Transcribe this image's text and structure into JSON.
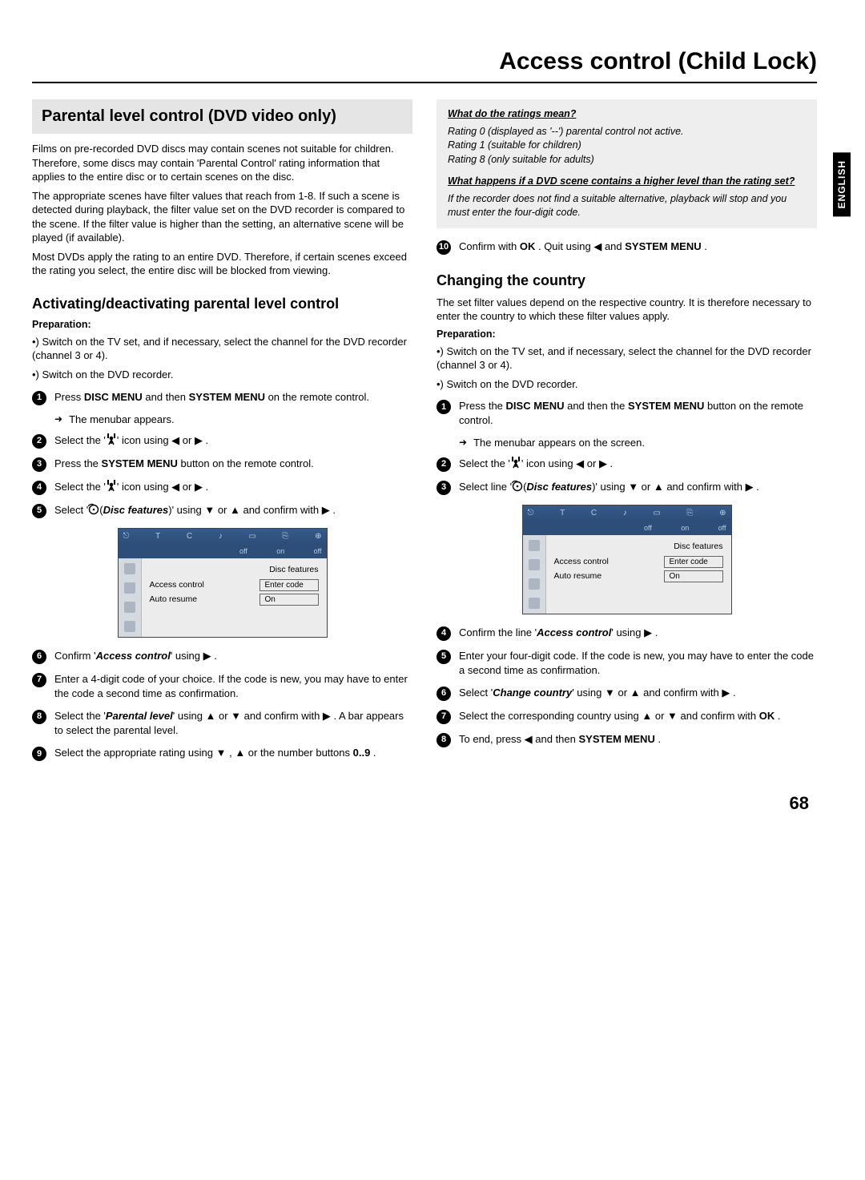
{
  "chapter_title": "Access control (Child Lock)",
  "language_tab": "ENGLISH",
  "page_number": "68",
  "left": {
    "banner": "Parental level control (DVD video only)",
    "intro_p1": "Films on pre-recorded DVD discs may contain scenes not suitable for children. Therefore, some discs may contain 'Parental Control' rating information that applies to the entire disc or to certain scenes on the disc.",
    "intro_p2": "The appropriate scenes have filter values that reach from 1-8. If such a scene is detected during playback, the filter value set on the DVD recorder is compared to the scene. If the filter value is higher than the setting, an alternative scene will be played (if available).",
    "intro_p3": "Most DVDs apply the rating to an entire DVD. Therefore, if certain scenes exceed the rating you select, the entire disc will be blocked from viewing.",
    "h_activate": "Activating/deactivating parental level control",
    "prep_label": "Preparation:",
    "prep_1": "•) Switch on the TV set, and if necessary, select the channel for the DVD recorder (channel 3 or 4).",
    "prep_2": "•) Switch on the DVD recorder.",
    "s1_a": "Press ",
    "s1_b": "DISC MENU",
    "s1_c": " and then ",
    "s1_d": "SYSTEM MENU",
    "s1_e": " on the remote control.",
    "s1_sub": "The menubar appears.",
    "s2_a": "Select the '",
    "s2_b": "' icon using ◀ or ▶ .",
    "s3_a": "Press the ",
    "s3_b": "SYSTEM MENU",
    "s3_c": " button on the remote control.",
    "s4_a": "Select the '",
    "s4_b": "' icon using ◀ or ▶ .",
    "s5_a": "Select '",
    "s5_feat": "Disc features",
    "s5_b": ")' using ▼ or ▲ and confirm with ▶ .",
    "s6_a": "Confirm '",
    "s6_b": "Access control",
    "s6_c": "' using ▶ .",
    "s7": "Enter a 4-digit code of your choice. If the code is new, you may have to enter the code a second time as confirmation.",
    "s8_a": "Select the '",
    "s8_b": "Parental level",
    "s8_c": "' using ▲ or ▼ and confirm with ▶ . A bar appears to select the parental level.",
    "s9_a": "Select the appropriate rating using ▼ , ▲ or the number buttons ",
    "s9_b": "0..9",
    "s9_c": " ."
  },
  "osd": {
    "tabs": [
      "off",
      "on",
      "off"
    ],
    "title": "Disc features",
    "row1_label": "Access control",
    "row1_field": "Enter code",
    "row2_label": "Auto resume",
    "row2_field": "On"
  },
  "right": {
    "box1_q": "What do the ratings mean?",
    "box1_l1": "Rating 0 (displayed as '--') parental control not active.",
    "box1_l2": "Rating 1 (suitable for children)",
    "box1_l3": "Rating 8 (only suitable for adults)",
    "box1_q2": "What happens if a DVD scene contains a higher level than the rating set?",
    "box1_a2": "If the recorder does not find a suitable alternative, playback will stop and you must enter the four-digit code.",
    "s10_a": "Confirm with ",
    "s10_b": "OK",
    "s10_c": " . Quit using ◀ and ",
    "s10_d": "SYSTEM MENU",
    "s10_e": " .",
    "h_country": "Changing the country",
    "country_intro": "The set filter values depend on the respective country. It is therefore necessary to enter the country to which these filter values apply.",
    "prep_label": "Preparation:",
    "prep_1": "•) Switch on the TV set, and if necessary, select the channel for the DVD recorder (channel 3 or 4).",
    "prep_2": "•) Switch on the DVD recorder.",
    "c1_a": "Press the ",
    "c1_b": "DISC MENU",
    "c1_c": " and then the ",
    "c1_d": "SYSTEM MENU",
    "c1_e": " button on the remote control.",
    "c1_sub": "The menubar appears on the screen.",
    "c2_a": "Select the '",
    "c2_b": "' icon using ◀ or ▶ .",
    "c3_a": "Select line '",
    "c3_feat": "Disc features",
    "c3_b": ")' using ▼ or ▲ and confirm with ▶ .",
    "c4_a": "Confirm the line '",
    "c4_b": "Access control",
    "c4_c": "' using ▶ .",
    "c5": "Enter your four-digit code. If the code is new, you may have to enter the code a second time as confirmation.",
    "c6_a": "Select '",
    "c6_b": "Change country",
    "c6_c": "' using ▼ or ▲ and confirm with ▶ .",
    "c7_a": "Select the corresponding country using ▲ or ▼ and confirm with ",
    "c7_b": "OK",
    "c7_c": " .",
    "c8_a": "To end, press ◀ and then ",
    "c8_b": "SYSTEM MENU",
    "c8_c": " ."
  }
}
